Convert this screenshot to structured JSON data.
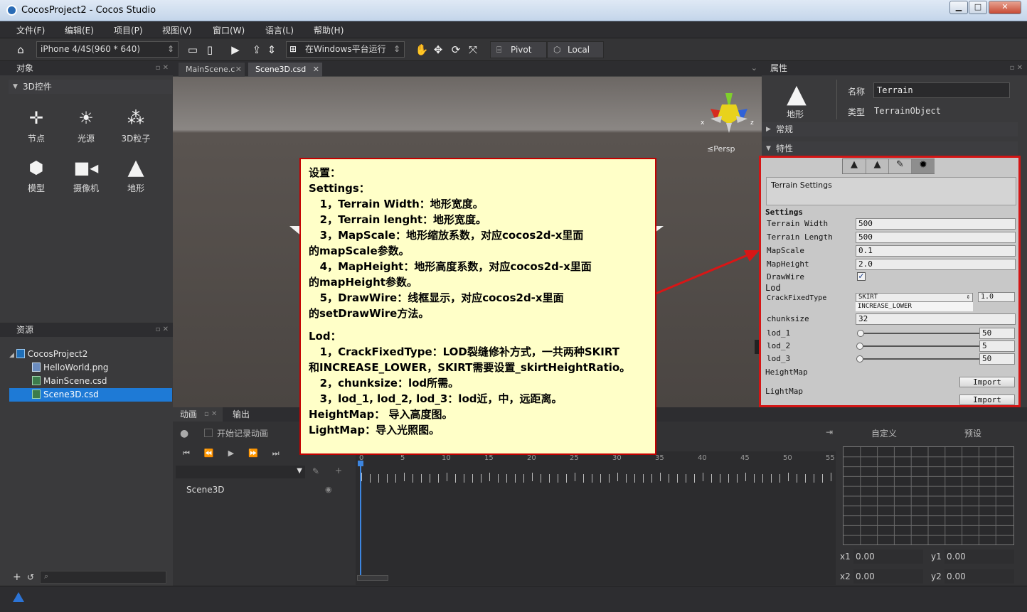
{
  "window": {
    "title": "CocosProject2 - Cocos Studio",
    "minimize": "▁",
    "maximize": "□",
    "close": "✕"
  },
  "menu": [
    "文件(F)",
    "编辑(E)",
    "项目(P)",
    "视图(V)",
    "窗口(W)",
    "语言(L)",
    "帮助(H)"
  ],
  "toolbar": {
    "device": "iPhone 4/4S(960 * 640)",
    "platform": "在Windows平台运行",
    "pivot": "Pivot",
    "local": "Local"
  },
  "objects_panel": {
    "title": "对象",
    "section": "3D控件",
    "controls": [
      "节点",
      "光源",
      "3D粒子",
      "模型",
      "摄像机",
      "地形"
    ]
  },
  "resources_panel": {
    "title": "资源",
    "items": [
      "CocosProject2",
      "HelloWorld.png",
      "MainScene.csd",
      "Scene3D.csd"
    ]
  },
  "tabs": [
    "MainScene.c",
    "Scene3D.csd"
  ],
  "viewport": {
    "persp": "≤Persp",
    "axis_x": "x",
    "axis_z": "z"
  },
  "properties": {
    "title": "属性",
    "icon_label": "地形",
    "name_label": "名称",
    "name_value": "Terrain",
    "type_label": "类型",
    "type_value": "TerrainObject",
    "section_general": "常规",
    "section_feature": "特性"
  },
  "terrain_inspector": {
    "header": "Terrain Settings",
    "settings": "Settings",
    "rows": [
      {
        "label": "Terrain Width",
        "value": "500"
      },
      {
        "label": "Terrain Length",
        "value": "500"
      },
      {
        "label": "MapScale",
        "value": "0.1"
      },
      {
        "label": "MapHeight",
        "value": "2.0"
      }
    ],
    "drawwire_label": "DrawWire",
    "drawwire_checked": true,
    "lod": "Lod",
    "crack_label": "CrackFixedType",
    "crack_value": "SKIRT",
    "crack_ratio": "1.0",
    "crack_option": "INCREASE_LOWER",
    "chunksize_label": "chunksize",
    "chunksize_value": "32",
    "lods": [
      {
        "label": "lod_1",
        "value": "50"
      },
      {
        "label": "lod_2",
        "value": "5"
      },
      {
        "label": "lod_3",
        "value": "50"
      }
    ],
    "heightmap": "HeightMap",
    "lightmap": "LightMap",
    "import": "Import"
  },
  "note": {
    "lines": [
      "设置：",
      "Settings：",
      "   1，Terrain Width：地形宽度。",
      "   2，Terrain lenght：地形宽度。",
      "   3，MapScale：地形缩放系数，对应cocos2d-x里面",
      "的mapScale参数。",
      "   4，MapHeight：地形高度系数，对应cocos2d-x里面",
      "的mapHeight参数。",
      "   5，DrawWire：线框显示，对应cocos2d-x里面",
      "的setDrawWire方法。",
      "",
      "Lod：",
      "   1，CrackFixedType：LOD裂缝修补方式，一共两种SKIRT",
      "和INCREASE_LOWER，SKIRT需要设置_skirtHeightRatio。",
      "   2，chunksize：lod所需。",
      "   3，lod_1, lod_2, lod_3：lod近，中，远距离。",
      "HeightMap： 导入高度图。",
      "LightMap：导入光照图。"
    ]
  },
  "animation": {
    "tab_anim": "动画",
    "tab_output": "输出",
    "record": "开始记录动画",
    "node": "Scene3D",
    "ticks": [
      "0",
      "5",
      "10",
      "15",
      "20",
      "25",
      "30",
      "35",
      "40",
      "45",
      "50",
      "55"
    ],
    "custom": "自定义",
    "preset": "预设",
    "x1": "x1",
    "x1_val": "0.00",
    "y1": "y1",
    "y1_val": "0.00",
    "x2": "x2",
    "x2_val": "0.00",
    "y2": "y2",
    "y2_val": "0.00"
  },
  "status": {
    "warning_icon": "warning-icon"
  }
}
